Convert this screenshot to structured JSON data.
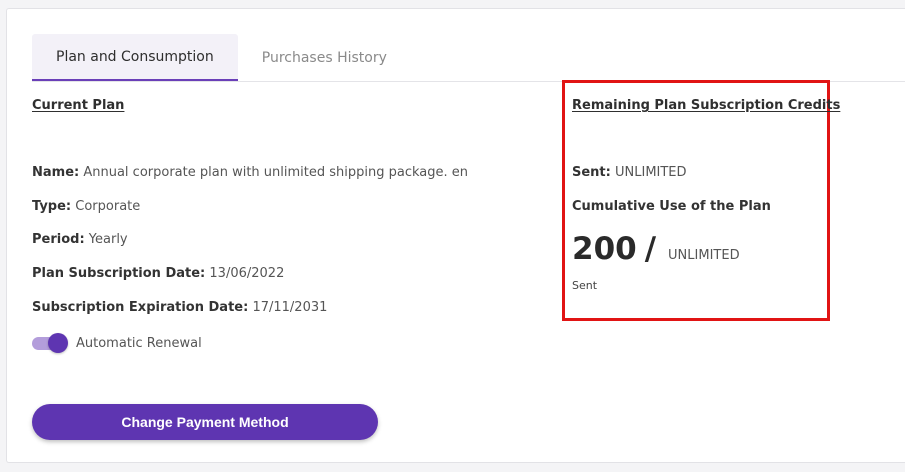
{
  "tabs": [
    {
      "label": "Plan and Consumption",
      "active": true
    },
    {
      "label": "Purchases History",
      "active": false
    }
  ],
  "current_plan": {
    "title": "Current Plan",
    "name_label": "Name:",
    "name_value": "Annual corporate plan with unlimited shipping package. en",
    "type_label": "Type:",
    "type_value": "Corporate",
    "period_label": "Period:",
    "period_value": "Yearly",
    "subscription_date_label": "Plan Subscription Date:",
    "subscription_date_value": "13/06/2022",
    "expiration_date_label": "Subscription Expiration Date:",
    "expiration_date_value": "17/11/2031",
    "auto_renewal_label": "Automatic Renewal",
    "auto_renewal_on": true,
    "change_payment_label": "Change Payment Method"
  },
  "credits": {
    "title": "Remaining Plan Subscription Credits",
    "sent_label": "Sent:",
    "sent_value": "UNLIMITED",
    "cumulative_heading": "Cumulative Use of the Plan",
    "used_value": "200",
    "separator": "/",
    "limit_value": "UNLIMITED",
    "usage_caption": "Sent"
  },
  "colors": {
    "accent": "#5e35b1",
    "toggle_track": "#b39ddb",
    "highlight_border": "#e11414",
    "active_tab_bg": "#f3f1f8"
  },
  "icons": {
    "toggle": "toggle-switch-on"
  }
}
